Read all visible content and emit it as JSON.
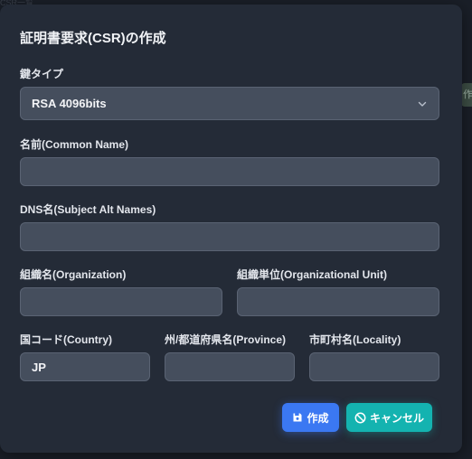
{
  "background": {
    "peek_left_text": "CSR一覧",
    "peek_right_text": "作"
  },
  "dialog": {
    "title": "証明書要求(CSR)の作成",
    "key_type": {
      "label": "鍵タイプ",
      "value": "RSA 4096bits"
    },
    "common_name": {
      "label": "名前(Common Name)",
      "value": "",
      "placeholder": ""
    },
    "dns_names": {
      "label": "DNS名(Subject Alt Names)",
      "value": "",
      "placeholder": ""
    },
    "organization": {
      "label": "組織名(Organization)",
      "value": ""
    },
    "organizational_unit": {
      "label": "組織単位(Organizational Unit)",
      "value": ""
    },
    "country": {
      "label": "国コード(Country)",
      "value": "JP"
    },
    "province": {
      "label": "州/都道府県名(Province)",
      "value": ""
    },
    "locality": {
      "label": "市町村名(Locality)",
      "value": ""
    },
    "buttons": {
      "create_label": "作成",
      "cancel_label": "キャンセル"
    }
  },
  "colors": {
    "primary": "#3b78f2",
    "secondary": "#14b3b0",
    "modal_bg": "#242b37",
    "field_bg": "#454e5d"
  },
  "icons": {
    "create": "floppy-disk-icon",
    "cancel": "ban-icon",
    "select": "chevron-down-icon"
  }
}
